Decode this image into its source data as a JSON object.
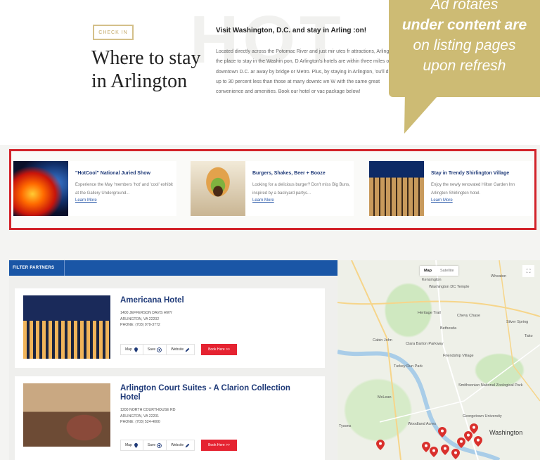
{
  "intro": {
    "watermark": "HOT",
    "check_in": "CHECK IN",
    "heading": "Where to stay in Arlington",
    "title": "Visit Washington, D.C. and stay in Arling :on!",
    "body": "Located directly across the Potomac River and just mir utes fr attractions, Arlington is the place to stay in the Washin pon, D Arlington's hotels are within three miles of downtown D.C. ar away by bridge or Metro. Plus, by staying in Arlington, 'ou'll d rates up to 30 percent less than those at many downtc wn W with the same great convenience and amenities. Book our hotel or vac package below!"
  },
  "callout": {
    "line1": "Ad rotates",
    "line2": "under content are",
    "line3": "on listing pages",
    "line4": "upon refresh",
    "color": "#cdbb74"
  },
  "ads": [
    {
      "title": "\"HotCool\" National Juried Show",
      "desc": "Experience the May 'members 'hot' and 'cool' exhibit at the Gallery Underground...",
      "link": "Learn More"
    },
    {
      "title": "Burgers, Shakes, Beer + Booze",
      "desc": "Looking for a delicious burger? Don't miss Big Buns, inspired by a backyard partys...",
      "link": "Learn More"
    },
    {
      "title": "Stay in Trendy Shirlington Village",
      "desc": "Enjoy the newly renovated Hilton Garden Inn Arlington Shirlington hotel.",
      "link": "Learn More"
    }
  ],
  "filter": {
    "tab": "FILTER PARTNERS"
  },
  "hotels": [
    {
      "name": "Americana Hotel",
      "addr1": "1400 JEFFERSON DAVIS HWY",
      "addr2": "ARLINGTON, VA 22202",
      "phone": "PHONE: (703) 979-3772",
      "map": "Map",
      "save": "Save",
      "website": "Website",
      "book": "Book Here >>"
    },
    {
      "name": "Arlington Court Suites - A Clarion Collection Hotel",
      "addr1": "1200 NORTH COURTHOUSE RD",
      "addr2": "ARLINGTON, VA 22201",
      "phone": "PHONE: (703) 524-4000",
      "map": "Map",
      "save": "Save",
      "website": "Website",
      "book": "Book Here >>"
    }
  ],
  "map": {
    "type_map": "Map",
    "type_satellite": "Satellite",
    "fullscreen": "⛶",
    "labels": {
      "kensington": "Kensington",
      "wheaton": "Wheaton",
      "temple": "Washington DC Temple",
      "chevy": "Chevy Chase",
      "heritage": "Heritage Trail",
      "silver": "Silver Spring",
      "bethesda": "Bethesda",
      "tako": "Tako",
      "cabin": "Cabin John",
      "clara": "Clara Barton Parkway",
      "friend": "Friendship Village",
      "turkey": "Turkey Run Park",
      "smithsonian": "Smithsonian National Zoological Park",
      "mclean": "McLean",
      "georgetown": "Georgetown University",
      "woodland": "Woodland Acres",
      "washington": "Washington",
      "tysons": "Tysons"
    }
  },
  "colors": {
    "ad_border": "#d2232a",
    "filter_bar": "#1a56a6",
    "book_button": "#e52331",
    "hotel_name": "#1f3a78",
    "pin": "#d9302c"
  }
}
